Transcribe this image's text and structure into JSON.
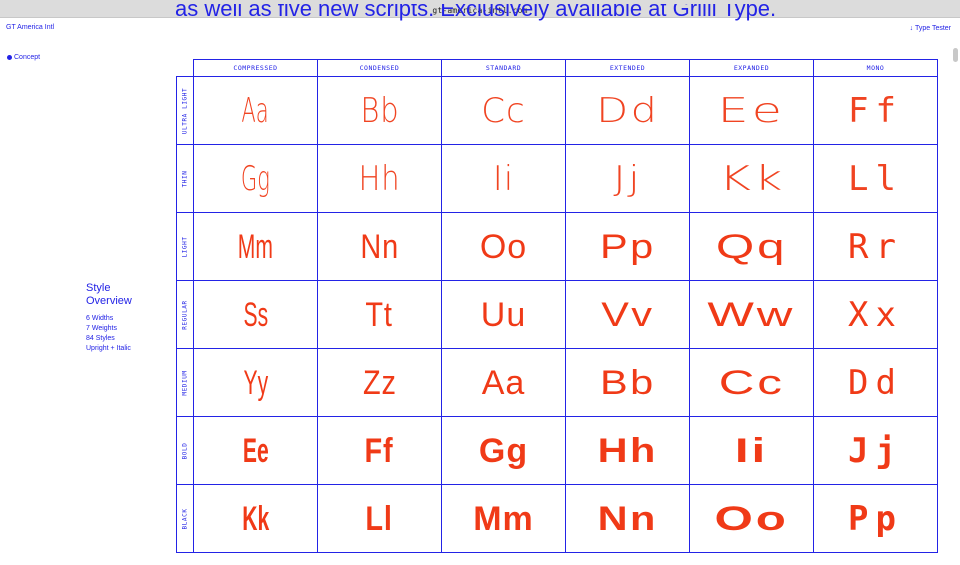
{
  "browser": {
    "url": "gt-america-intl.com"
  },
  "header": {
    "headline": "as well as five new scripts. Exclusively available at Grilli Type.",
    "brand": "GT America Intl",
    "type_tester": "↓ Type Tester",
    "concept": "Concept"
  },
  "overview": {
    "title_line1": "Style",
    "title_line2": "Overview",
    "facts": [
      "6 Widths",
      "7 Weights",
      "84 Styles",
      "Upright + Italic"
    ]
  },
  "grid": {
    "widths": [
      "COMPRESSED",
      "CONDENSED",
      "STANDARD",
      "EXTENDED",
      "EXPANDED",
      "MONO"
    ],
    "weights": [
      "ULTRA LIGHT",
      "THIN",
      "LIGHT",
      "REGULAR",
      "MEDIUM",
      "BOLD",
      "BLACK"
    ],
    "rows": [
      [
        "Aa",
        "Bb",
        "Cc",
        "Dd",
        "Ee",
        "Ff"
      ],
      [
        "Gg",
        "Hh",
        "Ii",
        "Jj",
        "Kk",
        "Ll"
      ],
      [
        "Mm",
        "Nn",
        "Oo",
        "Pp",
        "Qq",
        "Rr"
      ],
      [
        "Ss",
        "Tt",
        "Uu",
        "Vv",
        "Ww",
        "Xx"
      ],
      [
        "Yy",
        "Zz",
        "Aa",
        "Bb",
        "Cc",
        "Dd"
      ],
      [
        "Ee",
        "Ff",
        "Gg",
        "Hh",
        "Ii",
        "Jj"
      ],
      [
        "Kk",
        "Ll",
        "Mm",
        "Nn",
        "Oo",
        "Pp"
      ]
    ]
  },
  "colors": {
    "accent": "#2323e6",
    "glyph": "#f03a17",
    "background": "#ffffff"
  }
}
